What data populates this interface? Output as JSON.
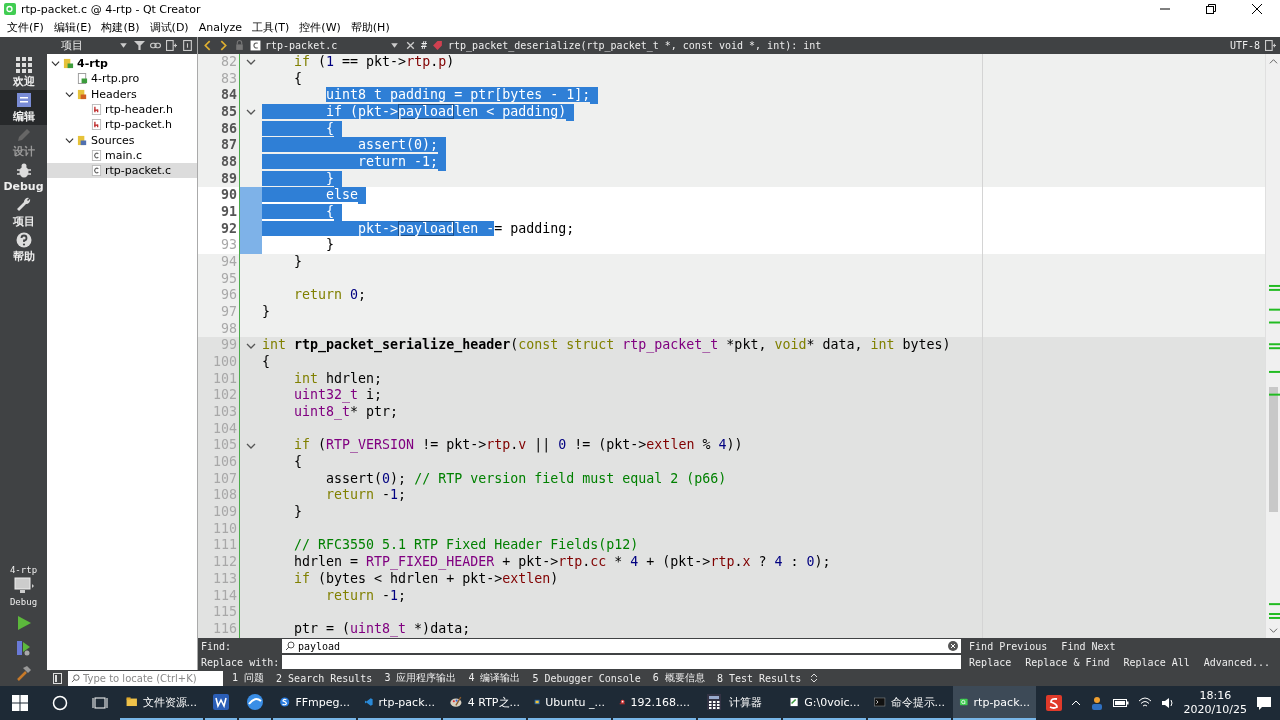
{
  "window": {
    "title": "rtp-packet.c @ 4-rtp - Qt Creator"
  },
  "menu": [
    "文件(F)",
    "编辑(E)",
    "构建(B)",
    "调试(D)",
    "Analyze",
    "工具(T)",
    "控件(W)",
    "帮助(H)"
  ],
  "modes": [
    {
      "label": "欢迎",
      "kind": "welcome",
      "selected": false,
      "disabled": false
    },
    {
      "label": "编辑",
      "kind": "edit",
      "selected": true,
      "disabled": false
    },
    {
      "label": "设计",
      "kind": "design",
      "selected": false,
      "disabled": true
    },
    {
      "label": "Debug",
      "kind": "debug",
      "selected": false,
      "disabled": false
    },
    {
      "label": "项目",
      "kind": "projects",
      "selected": false,
      "disabled": false
    },
    {
      "label": "帮助",
      "kind": "help",
      "selected": false,
      "disabled": false
    }
  ],
  "kit": {
    "project": "4-rtp",
    "config": "Debug"
  },
  "project_panel": {
    "title": "项目",
    "tree": [
      {
        "label": "4-rtp",
        "kind": "project",
        "selected": false,
        "expanded": true,
        "children": [
          {
            "label": "4-rtp.pro",
            "kind": "pro",
            "selected": false
          },
          {
            "label": "Headers",
            "kind": "headers",
            "selected": false,
            "expanded": true,
            "children": [
              {
                "label": "rtp-header.h",
                "kind": "header",
                "selected": false
              },
              {
                "label": "rtp-packet.h",
                "kind": "header",
                "selected": false
              }
            ]
          },
          {
            "label": "Sources",
            "kind": "sources",
            "selected": false,
            "expanded": true,
            "children": [
              {
                "label": "main.c",
                "kind": "source",
                "selected": false
              },
              {
                "label": "rtp-packet.c",
                "kind": "source",
                "selected": true
              }
            ]
          }
        ]
      }
    ]
  },
  "editor": {
    "file": "rtp-packet.c",
    "hash": "#",
    "symbol": "rtp_packet_deserialize(rtp_packet_t *, const void *, int): int",
    "encoding": "UTF-8",
    "lines": [
      {
        "n": "82",
        "current": false,
        "shaded": false,
        "selected": false,
        "fold": true,
        "tokens": [
          {
            "kind": "kw",
            "text": "    if"
          },
          {
            "kind": "p",
            "text": " ("
          },
          {
            "kind": "num",
            "text": "1"
          },
          {
            "kind": "p",
            "text": " == pkt->"
          },
          {
            "kind": "fld",
            "text": "rtp"
          },
          {
            "kind": "p",
            "text": "."
          },
          {
            "kind": "fld",
            "text": "p"
          },
          {
            "kind": "p",
            "text": ")"
          }
        ]
      },
      {
        "n": "83",
        "current": false,
        "shaded": false,
        "selected": false,
        "fold": false,
        "tokens": [
          {
            "kind": "p",
            "text": "    {"
          }
        ]
      },
      {
        "n": "84",
        "current": false,
        "shaded": false,
        "selected": true,
        "fold": false,
        "tokens": [
          {
            "kind": "selstart",
            "text": "        uint8_t padding = ptr[bytes - 1];"
          }
        ]
      },
      {
        "n": "85",
        "current": false,
        "shaded": false,
        "selected": true,
        "fold": true,
        "tokens": [
          {
            "kind": "sel",
            "text": "        if (pkt->"
          },
          {
            "kind": "selm",
            "text": "payload"
          },
          {
            "kind": "sel",
            "text": "len < padding)"
          }
        ]
      },
      {
        "n": "86",
        "current": false,
        "shaded": false,
        "selected": true,
        "fold": false,
        "tokens": [
          {
            "kind": "sel",
            "text": "        {"
          }
        ]
      },
      {
        "n": "87",
        "current": false,
        "shaded": false,
        "selected": true,
        "fold": false,
        "tokens": [
          {
            "kind": "sel",
            "text": "            assert(0);"
          }
        ]
      },
      {
        "n": "88",
        "current": false,
        "shaded": false,
        "selected": true,
        "fold": false,
        "tokens": [
          {
            "kind": "sel",
            "text": "            return -1;"
          }
        ]
      },
      {
        "n": "89",
        "current": false,
        "shaded": false,
        "selected": true,
        "fold": false,
        "tokens": [
          {
            "kind": "sel",
            "text": "        }"
          }
        ]
      },
      {
        "n": "90",
        "current": true,
        "shaded": false,
        "selected": true,
        "fold": false,
        "tokens": [
          {
            "kind": "sel",
            "text": "        else"
          }
        ]
      },
      {
        "n": "91",
        "current": true,
        "shaded": false,
        "selected": true,
        "fold": false,
        "tokens": [
          {
            "kind": "sel",
            "text": "        {"
          }
        ]
      },
      {
        "n": "92",
        "current": true,
        "shaded": false,
        "selected": true,
        "fold": false,
        "tokens": [
          {
            "kind": "sel",
            "text": "            pkt->"
          },
          {
            "kind": "selm",
            "text": "payload"
          },
          {
            "kind": "sel",
            "text": "len -"
          },
          {
            "kind": "p",
            "text": "= padding;"
          }
        ]
      },
      {
        "n": "93",
        "current": true,
        "shaded": false,
        "selected": false,
        "fold": false,
        "tokens": [
          {
            "kind": "p",
            "text": "        }"
          }
        ]
      },
      {
        "n": "94",
        "current": false,
        "shaded": false,
        "selected": false,
        "fold": false,
        "tokens": [
          {
            "kind": "p",
            "text": "    }"
          }
        ]
      },
      {
        "n": "95",
        "current": false,
        "shaded": false,
        "selected": false,
        "fold": false
      },
      {
        "n": "96",
        "current": false,
        "shaded": false,
        "selected": false,
        "fold": false,
        "tokens": [
          {
            "kind": "kw",
            "text": "    return "
          },
          {
            "kind": "num",
            "text": "0"
          },
          {
            "kind": "p",
            "text": ";"
          }
        ]
      },
      {
        "n": "97",
        "current": false,
        "shaded": false,
        "selected": false,
        "fold": false,
        "tokens": [
          {
            "kind": "p",
            "text": "}"
          }
        ]
      },
      {
        "n": "98",
        "current": false,
        "shaded": false,
        "selected": false,
        "fold": false
      },
      {
        "n": "99",
        "current": false,
        "shaded": true,
        "selected": false,
        "fold": true,
        "tokens": [
          {
            "kind": "kw",
            "text": "int "
          },
          {
            "kind": "fn",
            "text": "rtp_packet_serialize_header"
          },
          {
            "kind": "p",
            "text": "("
          },
          {
            "kind": "kw",
            "text": "const struct "
          },
          {
            "kind": "ty",
            "text": "rtp_packet_t"
          },
          {
            "kind": "p",
            "text": " *pkt, "
          },
          {
            "kind": "kw",
            "text": "void"
          },
          {
            "kind": "p",
            "text": "* data, "
          },
          {
            "kind": "kw",
            "text": "int"
          },
          {
            "kind": "p",
            "text": " bytes)"
          }
        ]
      },
      {
        "n": "100",
        "current": false,
        "shaded": true,
        "selected": false,
        "fold": false,
        "tokens": [
          {
            "kind": "p",
            "text": "{"
          }
        ]
      },
      {
        "n": "101",
        "current": false,
        "shaded": true,
        "selected": false,
        "fold": false,
        "tokens": [
          {
            "kind": "kw",
            "text": "    int"
          },
          {
            "kind": "p",
            "text": " hdrlen;"
          }
        ]
      },
      {
        "n": "102",
        "current": false,
        "shaded": true,
        "selected": false,
        "fold": false,
        "tokens": [
          {
            "kind": "ty",
            "text": "    uint32_t"
          },
          {
            "kind": "p",
            "text": " i;"
          }
        ]
      },
      {
        "n": "103",
        "current": false,
        "shaded": true,
        "selected": false,
        "fold": false,
        "tokens": [
          {
            "kind": "ty",
            "text": "    uint8_t"
          },
          {
            "kind": "p",
            "text": "* ptr;"
          }
        ]
      },
      {
        "n": "104",
        "current": false,
        "shaded": true,
        "selected": false,
        "fold": false
      },
      {
        "n": "105",
        "current": false,
        "shaded": true,
        "selected": false,
        "fold": true,
        "tokens": [
          {
            "kind": "kw",
            "text": "    if"
          },
          {
            "kind": "p",
            "text": " ("
          },
          {
            "kind": "mac",
            "text": "RTP_VERSION"
          },
          {
            "kind": "p",
            "text": " != pkt->"
          },
          {
            "kind": "fld",
            "text": "rtp"
          },
          {
            "kind": "p",
            "text": "."
          },
          {
            "kind": "fld",
            "text": "v"
          },
          {
            "kind": "p",
            "text": " || "
          },
          {
            "kind": "num",
            "text": "0"
          },
          {
            "kind": "p",
            "text": " != (pkt->"
          },
          {
            "kind": "fld",
            "text": "extlen"
          },
          {
            "kind": "p",
            "text": " % "
          },
          {
            "kind": "num",
            "text": "4"
          },
          {
            "kind": "p",
            "text": "))"
          }
        ]
      },
      {
        "n": "106",
        "current": false,
        "shaded": true,
        "selected": false,
        "fold": false,
        "tokens": [
          {
            "kind": "p",
            "text": "    {"
          }
        ]
      },
      {
        "n": "107",
        "current": false,
        "shaded": true,
        "selected": false,
        "fold": false,
        "tokens": [
          {
            "kind": "p",
            "text": "        assert("
          },
          {
            "kind": "num",
            "text": "0"
          },
          {
            "kind": "p",
            "text": "); "
          },
          {
            "kind": "cm",
            "text": "// RTP version field must equal 2 (p66)"
          }
        ]
      },
      {
        "n": "108",
        "current": false,
        "shaded": true,
        "selected": false,
        "fold": false,
        "tokens": [
          {
            "kind": "kw",
            "text": "        return"
          },
          {
            "kind": "p",
            "text": " -"
          },
          {
            "kind": "num",
            "text": "1"
          },
          {
            "kind": "p",
            "text": ";"
          }
        ]
      },
      {
        "n": "109",
        "current": false,
        "shaded": true,
        "selected": false,
        "fold": false,
        "tokens": [
          {
            "kind": "p",
            "text": "    }"
          }
        ]
      },
      {
        "n": "110",
        "current": false,
        "shaded": true,
        "selected": false,
        "fold": false
      },
      {
        "n": "111",
        "current": false,
        "shaded": true,
        "selected": false,
        "fold": false,
        "tokens": [
          {
            "kind": "cm",
            "text": "    // RFC3550 5.1 RTP Fixed Header Fields(p12)"
          }
        ]
      },
      {
        "n": "112",
        "current": false,
        "shaded": true,
        "selected": false,
        "fold": false,
        "tokens": [
          {
            "kind": "p",
            "text": "    hdrlen = "
          },
          {
            "kind": "mac",
            "text": "RTP_FIXED_HEADER"
          },
          {
            "kind": "p",
            "text": " + pkt->"
          },
          {
            "kind": "fld",
            "text": "rtp"
          },
          {
            "kind": "p",
            "text": "."
          },
          {
            "kind": "fld",
            "text": "cc"
          },
          {
            "kind": "p",
            "text": " * "
          },
          {
            "kind": "num",
            "text": "4"
          },
          {
            "kind": "p",
            "text": " + (pkt->"
          },
          {
            "kind": "fld",
            "text": "rtp"
          },
          {
            "kind": "p",
            "text": "."
          },
          {
            "kind": "fld",
            "text": "x"
          },
          {
            "kind": "p",
            "text": " ? "
          },
          {
            "kind": "num",
            "text": "4"
          },
          {
            "kind": "p",
            "text": " : "
          },
          {
            "kind": "num",
            "text": "0"
          },
          {
            "kind": "p",
            "text": ");"
          }
        ]
      },
      {
        "n": "113",
        "current": false,
        "shaded": true,
        "selected": false,
        "fold": false,
        "tokens": [
          {
            "kind": "kw",
            "text": "    if"
          },
          {
            "kind": "p",
            "text": " (bytes < hdrlen + pkt->"
          },
          {
            "kind": "fld",
            "text": "extlen"
          },
          {
            "kind": "p",
            "text": ")"
          }
        ]
      },
      {
        "n": "114",
        "current": false,
        "shaded": true,
        "selected": false,
        "fold": false,
        "tokens": [
          {
            "kind": "kw",
            "text": "        return"
          },
          {
            "kind": "p",
            "text": " -"
          },
          {
            "kind": "num",
            "text": "1"
          },
          {
            "kind": "p",
            "text": ";"
          }
        ]
      },
      {
        "n": "115",
        "current": false,
        "shaded": true,
        "selected": false,
        "fold": false
      },
      {
        "n": "116",
        "current": false,
        "shaded": true,
        "selected": false,
        "fold": false,
        "tokens": [
          {
            "kind": "p",
            "text": "    ptr = ("
          },
          {
            "kind": "ty",
            "text": "uint8_t"
          },
          {
            "kind": "p",
            "text": " *)data;"
          }
        ]
      }
    ]
  },
  "find": {
    "find_label": "Find:",
    "value": "payload",
    "replace_label": "Replace with:",
    "find_buttons": [
      "Find Previous",
      "Find Next"
    ],
    "replace_buttons": [
      "Replace",
      "Replace & Find",
      "Replace All",
      "Advanced..."
    ]
  },
  "output_pane": {
    "locate_placeholder": "Type to locate (Ctrl+K)",
    "tabs": [
      {
        "label": "1 问题",
        "selected": false
      },
      {
        "label": "2 Search Results",
        "selected": false
      },
      {
        "label": "3 应用程序输出",
        "selected": false
      },
      {
        "label": "4 编译输出",
        "selected": false
      },
      {
        "label": "5 Debugger Console",
        "selected": false
      },
      {
        "label": "6 概要信息",
        "selected": false
      },
      {
        "label": "8 Test Results",
        "selected": false
      }
    ]
  },
  "taskbar": {
    "items": [
      {
        "label": "文件资源...",
        "kind": "folder",
        "selected": false
      },
      {
        "kind": "word",
        "selected": false
      },
      {
        "kind": "browser",
        "selected": false
      },
      {
        "label": "FFmpeg...",
        "kind": "sogou",
        "selected": false
      },
      {
        "label": "rtp-pack...",
        "kind": "vscode",
        "selected": false
      },
      {
        "label": "4 RTP之...",
        "kind": "paint",
        "selected": false
      },
      {
        "label": "Ubuntu _...",
        "kind": "vbox",
        "selected": false
      },
      {
        "label": "192.168....",
        "kind": "snail",
        "selected": false
      },
      {
        "label": "计算器",
        "kind": "calc",
        "selected": false
      },
      {
        "label": "G:\\0voic...",
        "kind": "notepad",
        "selected": false
      },
      {
        "label": "命令提示...",
        "kind": "cmd",
        "selected": false
      },
      {
        "label": "rtp-pack...",
        "kind": "qt",
        "selected": true
      }
    ],
    "time": "18:16",
    "date": "2020/10/25"
  }
}
